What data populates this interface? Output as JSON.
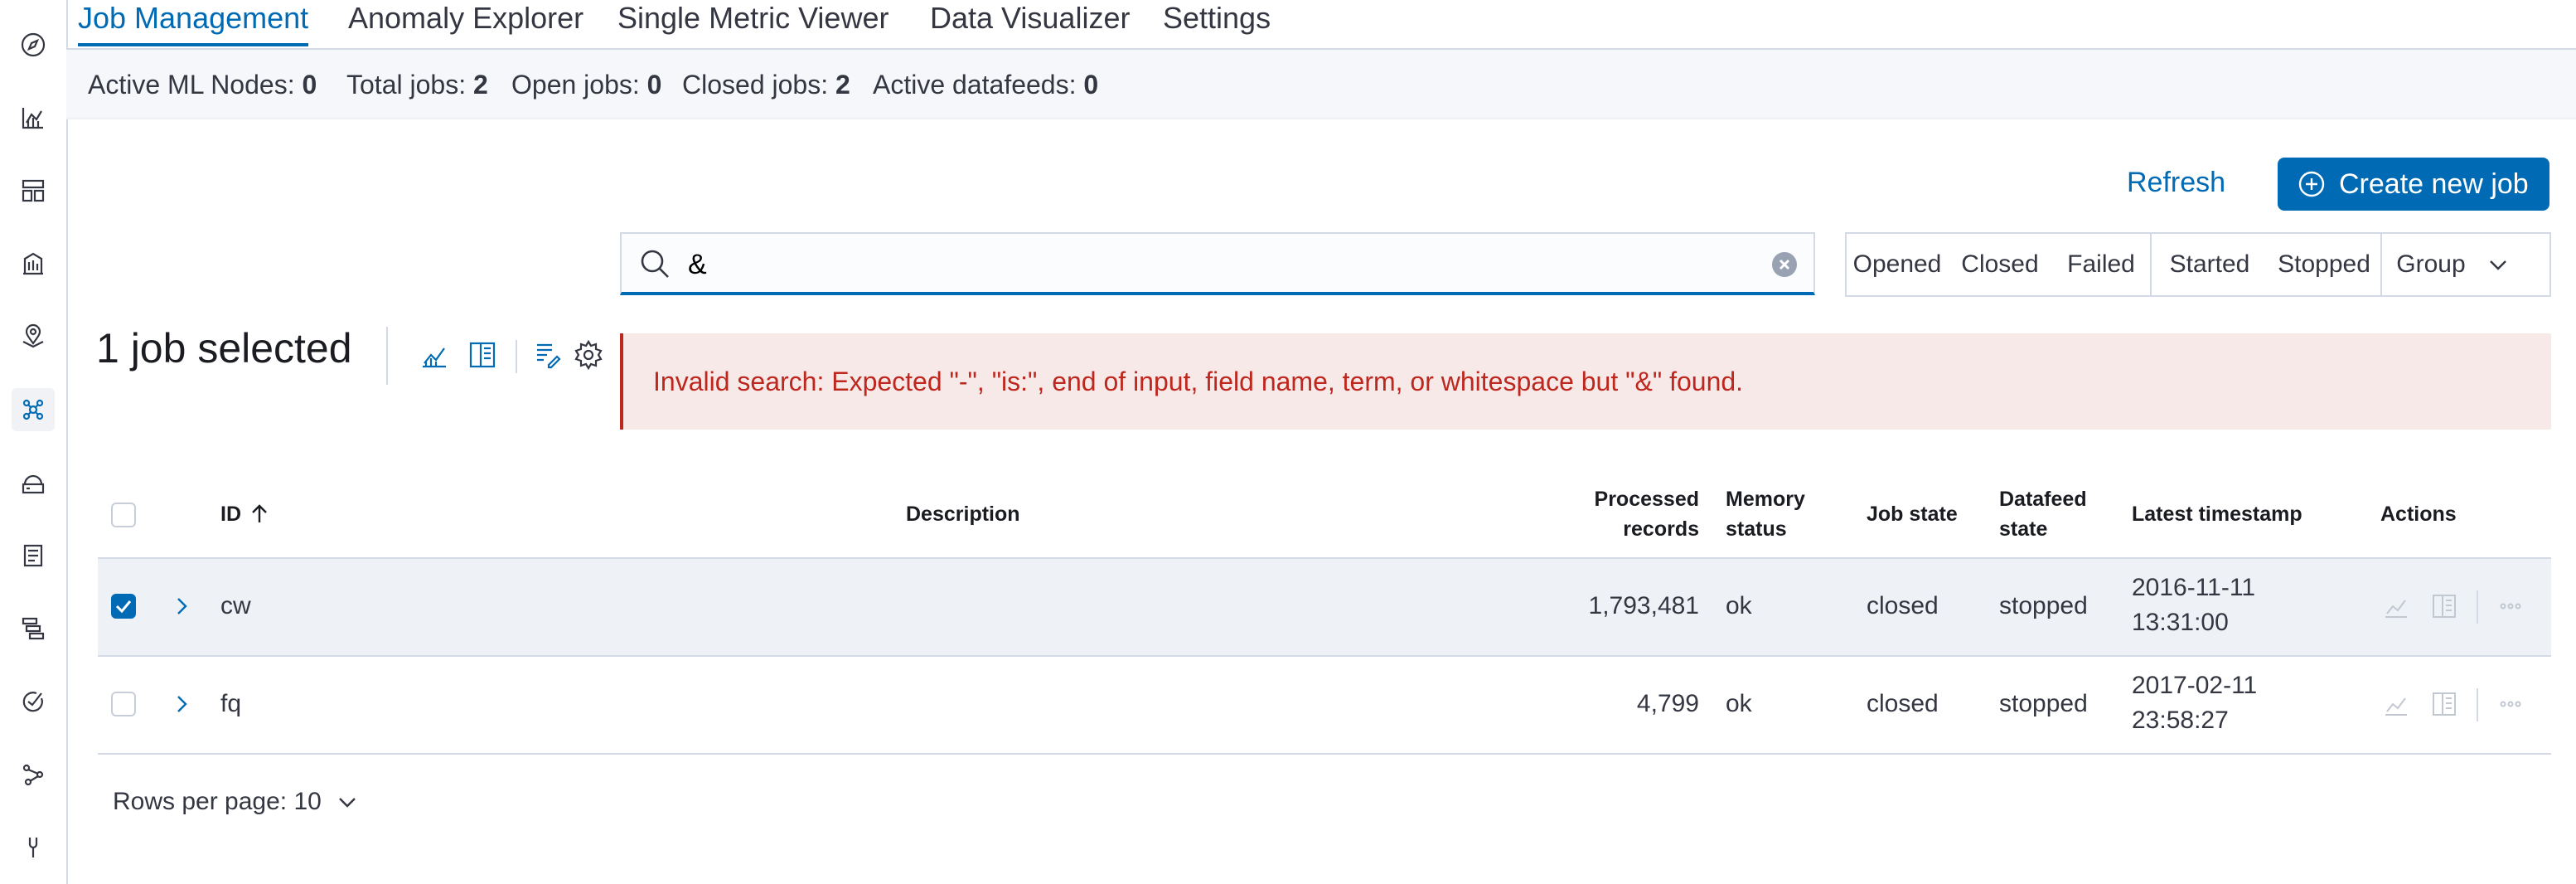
{
  "tabs": [
    "Job Management",
    "Anomaly Explorer",
    "Single Metric Viewer",
    "Data Visualizer",
    "Settings"
  ],
  "stats": [
    {
      "label": "Active ML Nodes:",
      "value": "0"
    },
    {
      "label": "Total jobs:",
      "value": "2"
    },
    {
      "label": "Open jobs:",
      "value": "0"
    },
    {
      "label": "Closed jobs:",
      "value": "2"
    },
    {
      "label": "Active datafeeds:",
      "value": "0"
    }
  ],
  "buttons": {
    "refresh": "Refresh",
    "create": "Create new job"
  },
  "search": {
    "value": "&"
  },
  "filters": [
    "Opened",
    "Closed",
    "Failed",
    "Started",
    "Stopped",
    "Group"
  ],
  "selection": {
    "label": "1 job selected"
  },
  "error": {
    "message": "Invalid search: Expected \"-\", \"is:\", end of input, field name, term, or whitespace but \"&\" found."
  },
  "table": {
    "headers": {
      "id": "ID",
      "description": "Description",
      "processed_1": "Processed",
      "processed_2": "records",
      "memory_1": "Memory",
      "memory_2": "status",
      "job_state": "Job state",
      "datafeed_1": "Datafeed",
      "datafeed_2": "state",
      "latest": "Latest timestamp",
      "actions": "Actions"
    },
    "rows": [
      {
        "id": "cw",
        "processed": "1,793,481",
        "memory": "ok",
        "job_state": "closed",
        "datafeed_state": "stopped",
        "ts_date": "2016-11-11",
        "ts_time": "13:31:00",
        "selected": true
      },
      {
        "id": "fq",
        "processed": "4,799",
        "memory": "ok",
        "job_state": "closed",
        "datafeed_state": "stopped",
        "ts_date": "2017-02-11",
        "ts_time": "23:58:27",
        "selected": false
      }
    ]
  },
  "pagination": {
    "rows_per_page": "Rows per page: 10"
  },
  "icons": {
    "nav": [
      "compass-icon",
      "visualize-icon",
      "dashboard-icon",
      "canvas-icon",
      "maps-icon",
      "machine-learning-icon",
      "infrastructure-icon",
      "logs-icon",
      "apm-icon",
      "uptime-icon",
      "graph-icon",
      "dev-tools-icon"
    ],
    "accent": "#006bb4",
    "error": "#bd271e"
  }
}
